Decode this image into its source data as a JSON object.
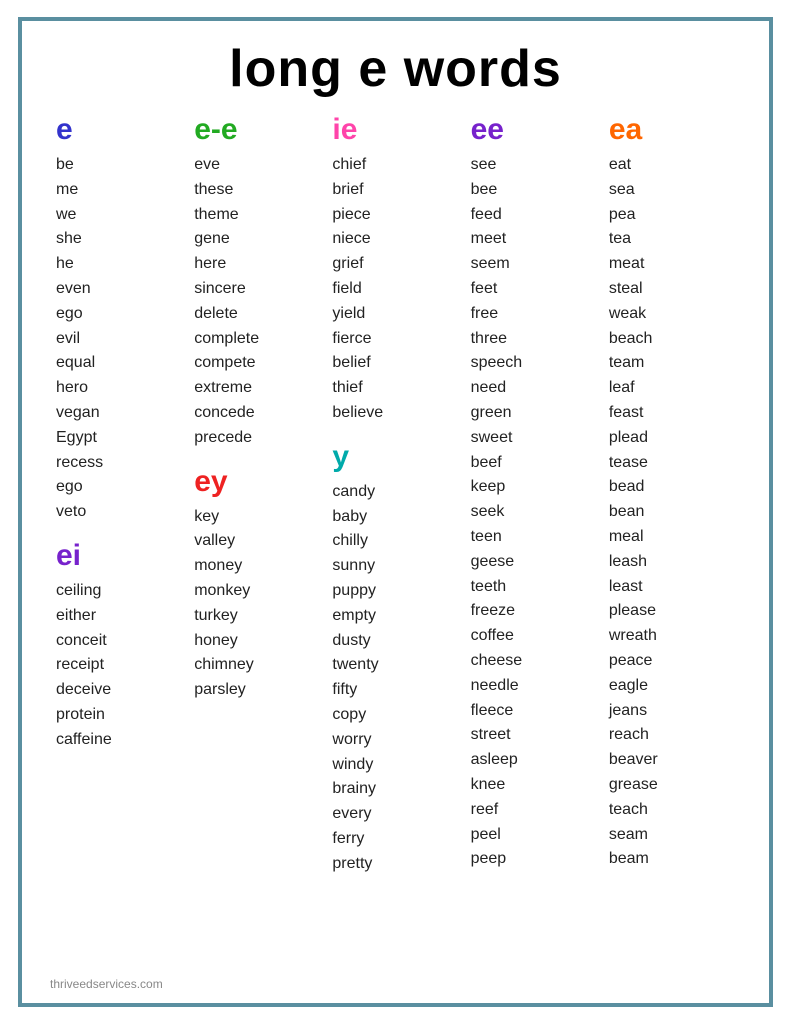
{
  "title": "long e words",
  "footer": "thriveedservices.com",
  "columns": [
    {
      "id": "col-e",
      "sections": [
        {
          "header": "e",
          "header_class": "blue",
          "words": [
            "be",
            "me",
            "we",
            "she",
            "he",
            "even",
            "ego",
            "evil",
            "equal",
            "hero",
            "vegan",
            "Egypt",
            "recess",
            "ego",
            "veto"
          ]
        },
        {
          "header": "ei",
          "header_class": "purple",
          "words": [
            "ceiling",
            "either",
            "conceit",
            "receipt",
            "deceive",
            "protein",
            "caffeine"
          ]
        }
      ]
    },
    {
      "id": "col-ee-e",
      "sections": [
        {
          "header": "e-e",
          "header_class": "green",
          "words": [
            "eve",
            "these",
            "theme",
            "gene",
            "here",
            "sincere",
            "delete",
            "complete",
            "compete",
            "extreme",
            "concede",
            "precede"
          ]
        },
        {
          "header": "ey",
          "header_class": "red",
          "words": [
            "key",
            "valley",
            "money",
            "monkey",
            "turkey",
            "honey",
            "chimney",
            "parsley"
          ]
        }
      ]
    },
    {
      "id": "col-ie",
      "sections": [
        {
          "header": "ie",
          "header_class": "pink",
          "words": [
            "chief",
            "brief",
            "piece",
            "niece",
            "grief",
            "field",
            "yield",
            "fierce",
            "belief",
            "thief",
            "believe"
          ]
        },
        {
          "header": "y",
          "header_class": "teal",
          "words": [
            "candy",
            "baby",
            "chilly",
            "sunny",
            "puppy",
            "empty",
            "dusty",
            "twenty",
            "fifty",
            "copy",
            "worry",
            "windy",
            "brainy",
            "every",
            "ferry",
            "pretty"
          ]
        }
      ]
    },
    {
      "id": "col-ee",
      "sections": [
        {
          "header": "ee",
          "header_class": "purple",
          "words": [
            "see",
            "bee",
            "feed",
            "meet",
            "seem",
            "feet",
            "free",
            "three",
            "speech",
            "need",
            "green",
            "sweet",
            "beef",
            "keep",
            "seek",
            "teen",
            "geese",
            "teeth",
            "freeze",
            "coffee",
            "cheese",
            "needle",
            "fleece",
            "street",
            "asleep",
            "knee",
            "reef",
            "peel",
            "peep"
          ]
        }
      ]
    },
    {
      "id": "col-ea",
      "sections": [
        {
          "header": "ea",
          "header_class": "orange",
          "words": [
            "eat",
            "sea",
            "pea",
            "tea",
            "meat",
            "steal",
            "weak",
            "beach",
            "team",
            "leaf",
            "feast",
            "plead",
            "tease",
            "bead",
            "bean",
            "meal",
            "leash",
            "least",
            "please",
            "wreath",
            "peace",
            "eagle",
            "jeans",
            "reach",
            "beaver",
            "grease",
            "teach",
            "seam",
            "beam"
          ]
        }
      ]
    }
  ]
}
